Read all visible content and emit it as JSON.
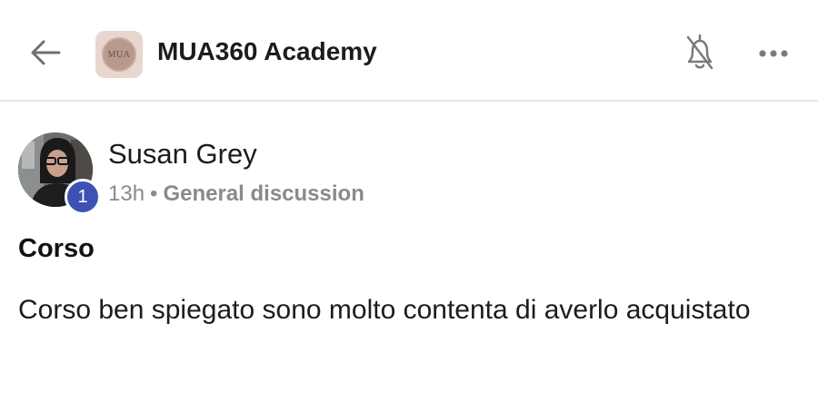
{
  "header": {
    "back_icon": "arrow-left-icon",
    "logo_text": "MUA",
    "title": "MUA360 Academy",
    "notifications_icon": "bell-off-icon",
    "more_icon": "more-horizontal-icon"
  },
  "post": {
    "author": {
      "name": "Susan Grey",
      "level": "1",
      "level_badge_color": "#3d52b4"
    },
    "time": "13h",
    "separator": "•",
    "category": "General discussion",
    "title": "Corso",
    "body": "Corso ben spiegato sono molto contenta di averlo acquistato"
  }
}
